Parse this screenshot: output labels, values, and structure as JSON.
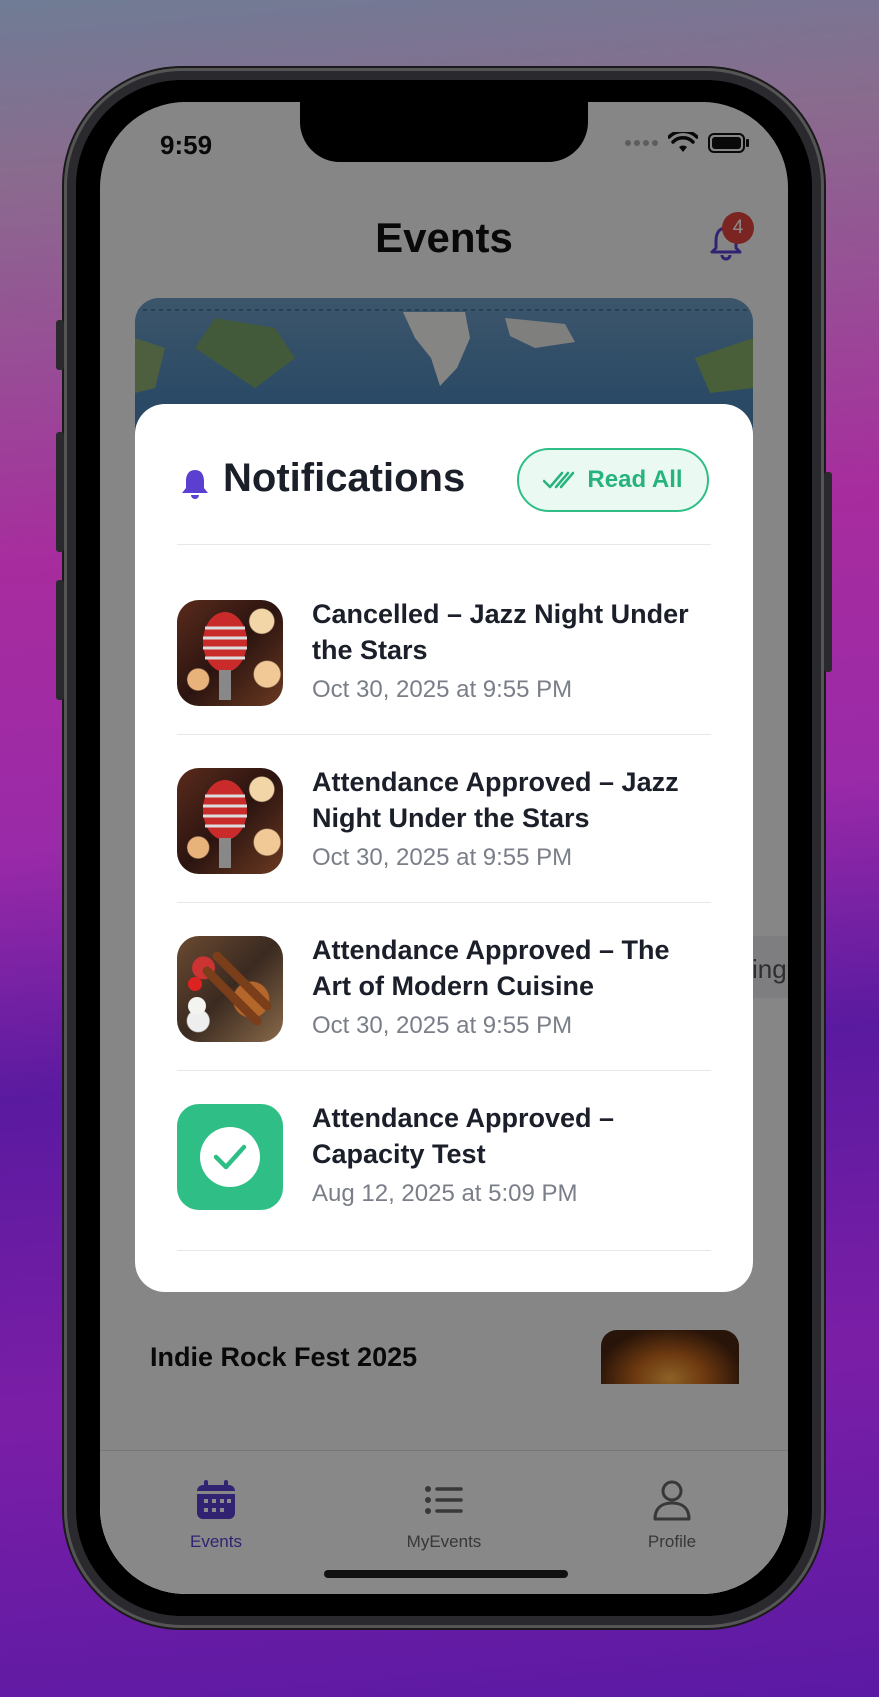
{
  "status_bar": {
    "time": "9:59"
  },
  "header": {
    "title": "Events",
    "notification_count": "4"
  },
  "background": {
    "featured_event_title": "Indie Rock Fest 2025",
    "partial_tag_text": "ing"
  },
  "tab_bar": {
    "items": [
      {
        "label": "Events",
        "icon": "calendar-icon",
        "active": true
      },
      {
        "label": "MyEvents",
        "icon": "list-icon",
        "active": false
      },
      {
        "label": "Profile",
        "icon": "person-icon",
        "active": false
      }
    ]
  },
  "notifications_modal": {
    "title": "Notifications",
    "read_all_label": "Read All",
    "items": [
      {
        "title": "Cancelled – Jazz Night Under the Stars",
        "date": "Oct 30, 2025 at 9:55 PM",
        "thumb": "microphone-image"
      },
      {
        "title": "Attendance Approved – Jazz Night Under the Stars",
        "date": "Oct 30, 2025 at 9:55 PM",
        "thumb": "microphone-image"
      },
      {
        "title": "Attendance Approved – The Art of Modern Cuisine",
        "date": "Oct 30, 2025 at 9:55 PM",
        "thumb": "food-platter-image"
      },
      {
        "title": "Attendance Approved – Capacity Test",
        "date": "Aug 12, 2025 at 5:09 PM",
        "thumb": "check-icon"
      }
    ]
  },
  "colors": {
    "accent_purple": "#5b3fd0",
    "accent_green": "#2fbf86",
    "badge_red": "#e0443f"
  }
}
